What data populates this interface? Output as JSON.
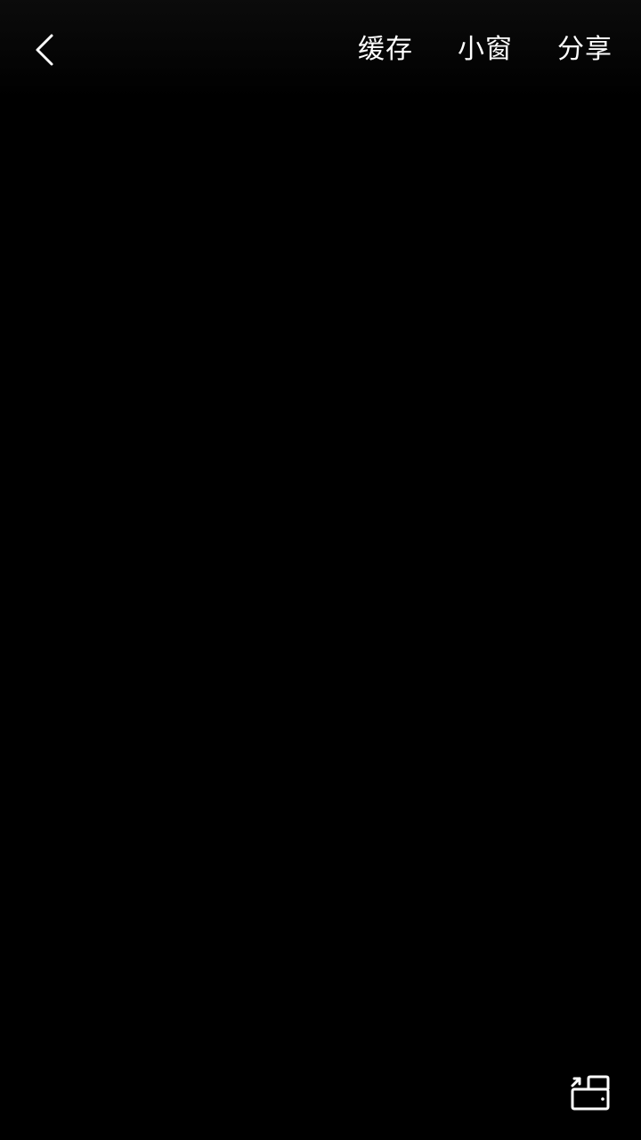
{
  "top_bar": {
    "back_icon": "chevron-left-icon",
    "actions": [
      {
        "label": "缓存"
      },
      {
        "label": "小窗"
      },
      {
        "label": "分享"
      }
    ]
  },
  "bottom_controls": {
    "rotate_icon": "screen-rotate-icon"
  },
  "colors": {
    "background": "#000000",
    "foreground": "#ffffff"
  }
}
